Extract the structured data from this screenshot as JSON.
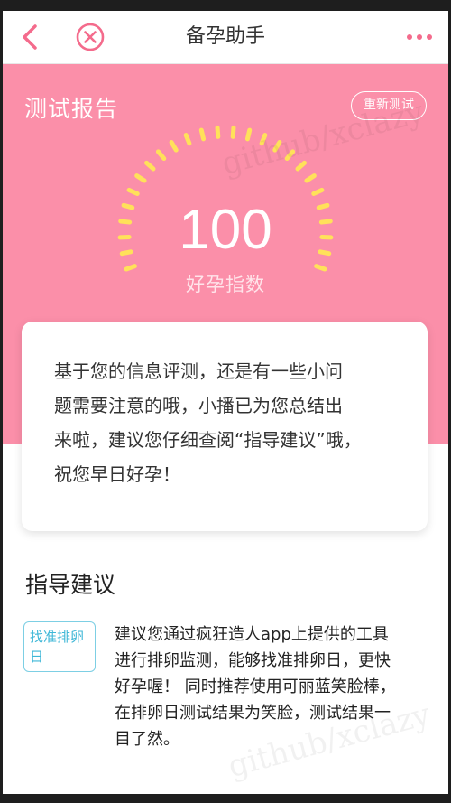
{
  "navbar": {
    "title": "备孕助手",
    "back_icon": "chevron-left-icon",
    "close_icon": "close-circle-icon",
    "more_icon": "more-dots-icon"
  },
  "hero": {
    "title": "测试报告",
    "retest_label": "重新测试",
    "score": "100",
    "score_label": "好孕指数",
    "background_color": "#fb8fa9",
    "gauge_color": "#ffe15a",
    "score_value": 100
  },
  "summary_card": {
    "line1": "基于您的信息评测，还是有一些小问",
    "line2": "题需要注意的哦，小播已为您总结出",
    "line3": "来啦，建议您仔细查阅“指导建议”哦，",
    "line4": "祝您早日好孕！"
  },
  "guidance": {
    "title": "指导建议",
    "tag_label": "找准排卵日",
    "line1": "建议您通过疯狂造人app上提供的工具",
    "line2": "进行排卵监测，能够找准排卵日，更快",
    "line3": "好孕喔！ 同时推荐使用可丽蓝笑脸棒，",
    "line4": "在排卵日测试结果为笑脸，测试结果一",
    "line5": "目了然。",
    "tag_color": "#3fb7d7"
  },
  "watermark": "github/xclazy"
}
